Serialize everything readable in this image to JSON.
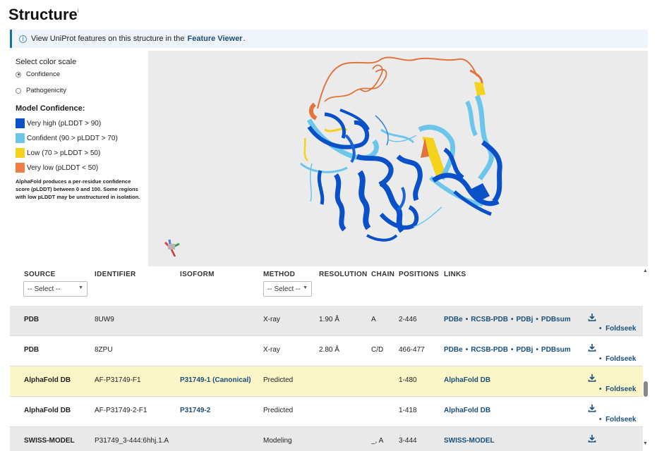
{
  "page": {
    "title": "Structure",
    "title_sup": "i"
  },
  "info_bar": {
    "prefix": "View UniProt features on this structure in the",
    "link": "Feature Viewer",
    "suffix": "."
  },
  "color_scale": {
    "heading": "Select color scale",
    "options": [
      {
        "label": "Confidence",
        "selected": true
      },
      {
        "label": "Pathogenicity",
        "selected": false
      }
    ]
  },
  "model_confidence": {
    "heading": "Model Confidence:",
    "levels": [
      {
        "label": "Very high (pLDDT > 90)",
        "color": "#0a50c8"
      },
      {
        "label": "Confident (90 > pLDDT > 70)",
        "color": "#6cc6ec"
      },
      {
        "label": "Low (70 > pLDDT > 50)",
        "color": "#f5d21c"
      },
      {
        "label": "Very low (pLDDT < 50)",
        "color": "#ef7d45"
      }
    ],
    "note": "AlphaFold produces a per-residue confidence score (pLDDT) between 0 and 100. Some regions with low pLDDT may be unstructured in isolation."
  },
  "table": {
    "headers": {
      "source": "SOURCE",
      "identifier": "IDENTIFIER",
      "isoform": "ISOFORM",
      "method": "METHOD",
      "resolution": "RESOLUTION",
      "chain": "CHAIN",
      "positions": "POSITIONS",
      "links": "LINKS"
    },
    "source_filter": "-- Select --",
    "method_filter": "-- Select --",
    "download_icon": "download-icon",
    "rows": [
      {
        "source": "PDB",
        "identifier": "8UW9",
        "isoform": "",
        "method": "X-ray",
        "resolution": "1.90 Å",
        "chain": "A",
        "positions": "2-446",
        "links": [
          "PDBe",
          "RCSB-PDB",
          "PDBj",
          "PDBsum"
        ],
        "foldseek": "Foldseek"
      },
      {
        "source": "PDB",
        "identifier": "8ZPU",
        "isoform": "",
        "method": "X-ray",
        "resolution": "2.80 Å",
        "chain": "C/D",
        "positions": "466-477",
        "links": [
          "PDBe",
          "RCSB-PDB",
          "PDBj",
          "PDBsum"
        ],
        "foldseek": "Foldseek"
      },
      {
        "source": "AlphaFold DB",
        "identifier": "AF-P31749-F1",
        "isoform": "P31749-1 (Canonical)",
        "method": "Predicted",
        "resolution": "",
        "chain": "",
        "positions": "1-480",
        "links": [
          "AlphaFold DB"
        ],
        "foldseek": "Foldseek"
      },
      {
        "source": "AlphaFold DB",
        "identifier": "AF-P31749-2-F1",
        "isoform": "P31749-2",
        "method": "Predicted",
        "resolution": "",
        "chain": "",
        "positions": "1-418",
        "links": [
          "AlphaFold DB"
        ],
        "foldseek": "Foldseek"
      },
      {
        "source": "SWISS-MODEL",
        "identifier": "P31749_3-444:6hhj.1.A",
        "isoform": "",
        "method": "Modeling",
        "resolution": "",
        "chain": "_, A",
        "positions": "3-444",
        "links": [
          "SWISS-MODEL"
        ],
        "foldseek": ""
      }
    ]
  }
}
